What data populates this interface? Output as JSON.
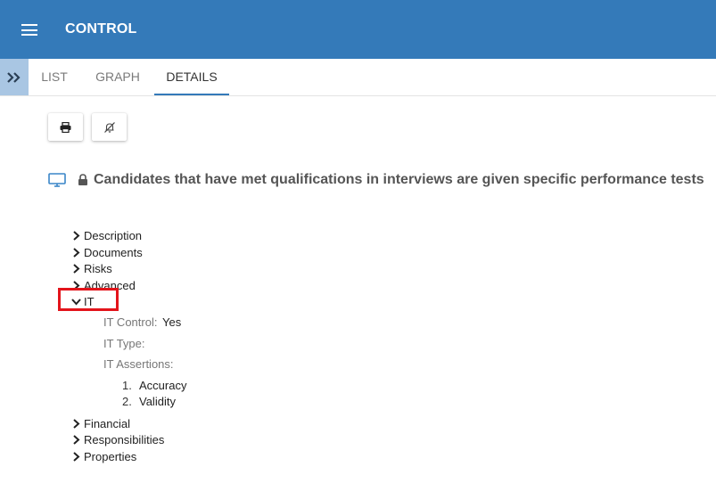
{
  "header": {
    "title": "CONTROL",
    "menu_icon": "hamburger-icon",
    "background": "#347ab9"
  },
  "tabs": [
    {
      "label": "LIST",
      "active": false
    },
    {
      "label": "GRAPH",
      "active": false
    },
    {
      "label": "DETAILS",
      "active": true
    }
  ],
  "sidebar_toggle_icon": "double-chevron-right-icon",
  "toolbar": {
    "print_icon": "print-icon",
    "notify_icon": "bell-off-icon"
  },
  "control": {
    "type_icon": "monitor-icon",
    "lock_icon": "lock-icon",
    "title": "Candidates that have met qualifications in interviews are given specific performance tests"
  },
  "sections_before": [
    "Description",
    "Documents",
    "Risks",
    "Advanced"
  ],
  "it_section": {
    "label": "IT",
    "expanded": true,
    "fields": {
      "it_control_label": "IT Control:",
      "it_control_value": "Yes",
      "it_type_label": "IT Type:",
      "it_assertions_label": "IT Assertions:"
    },
    "assertions": [
      {
        "num": "1.",
        "text": "Accuracy"
      },
      {
        "num": "2.",
        "text": "Validity"
      }
    ]
  },
  "sections_after": [
    "Financial",
    "Responsibilities",
    "Properties"
  ],
  "accent_colors": {
    "highlight_border": "#e3141b",
    "active_tab_underline": "#347ab9"
  }
}
